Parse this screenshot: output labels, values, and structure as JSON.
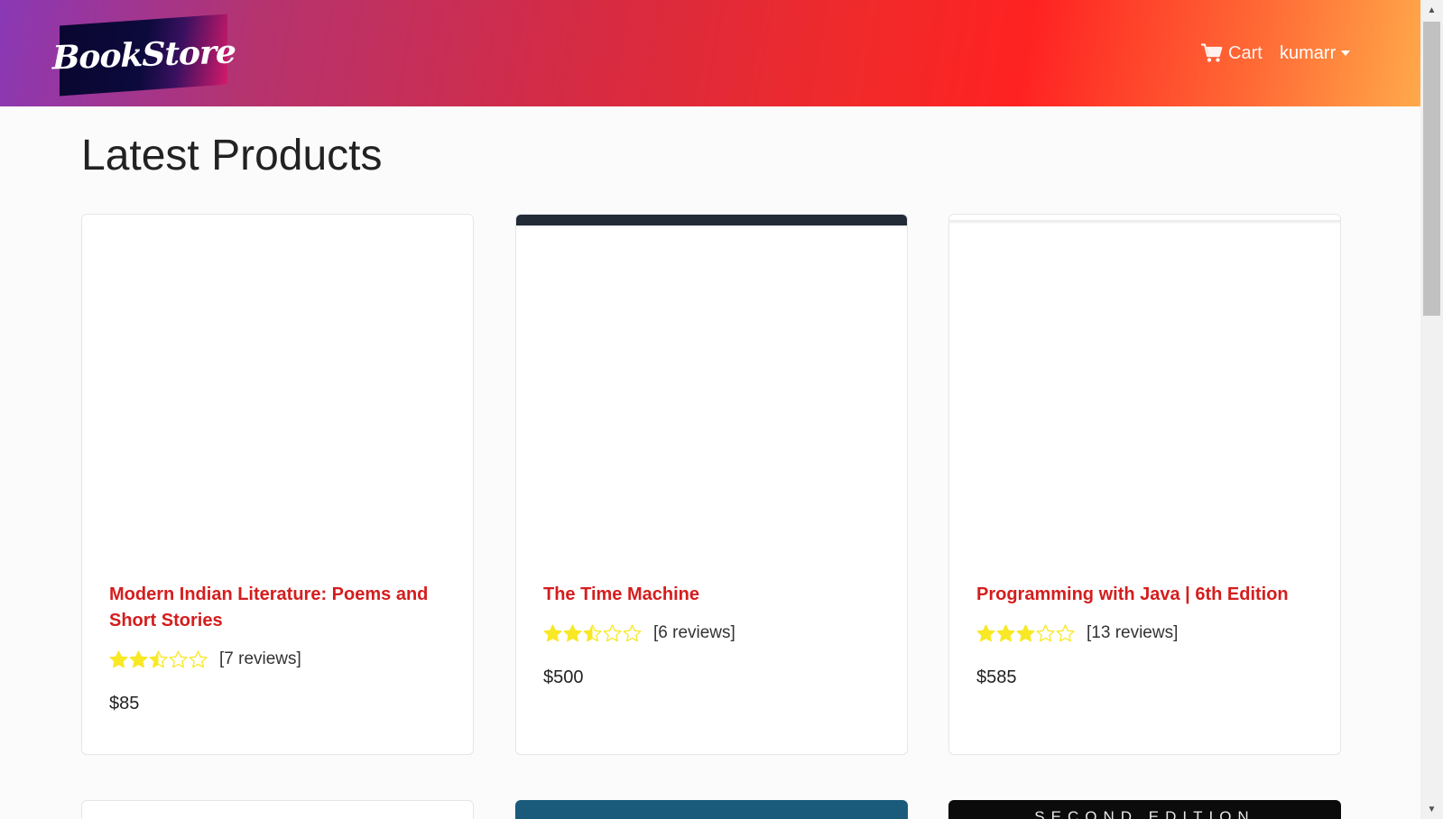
{
  "brand": {
    "logo_text": "BookStore"
  },
  "nav": {
    "cart_label": "Cart",
    "user_label": "kumarr"
  },
  "page": {
    "title": "Latest Products"
  },
  "products": [
    {
      "title": "Modern Indian Literature: Poems and Short Stories",
      "rating": 2.5,
      "reviews": "[7 reviews]",
      "price": "$85"
    },
    {
      "title": "The Time Machine",
      "rating": 2.5,
      "reviews": "[6 reviews]",
      "price": "$500"
    },
    {
      "title": "Programming with Java | 6th Edition",
      "rating": 3,
      "reviews": "[13 reviews]",
      "price": "$585"
    }
  ],
  "next_row": {
    "third_card_cover_text": "SECOND EDITION"
  },
  "colors": {
    "title_red": "#d51d1d",
    "star_yellow": "#f8e825",
    "navbar_gradient_start": "#8a38b5",
    "navbar_gradient_end": "#ffa94a"
  },
  "icons": [
    "cart-icon",
    "caret-down-icon",
    "star-icon"
  ]
}
